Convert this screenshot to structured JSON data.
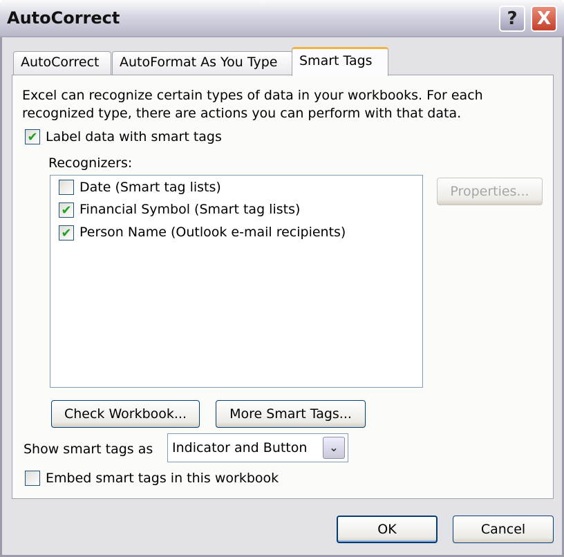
{
  "window": {
    "title": "AutoCorrect",
    "help_icon": "?",
    "close_icon": "X"
  },
  "tabs": [
    {
      "label": "AutoCorrect"
    },
    {
      "label": "AutoFormat As You Type"
    },
    {
      "label": "Smart Tags",
      "active": true
    }
  ],
  "smart_tags": {
    "description_line1": "Excel can recognize certain types of data in your workbooks.  For each",
    "description_line2": "recognized type, there are actions you can perform with that data.",
    "label_data": {
      "label": "Label data with smart tags",
      "checked": true
    },
    "recognizers_label": "Recognizers:",
    "recognizers": [
      {
        "label": "Date (Smart tag lists)",
        "checked": false
      },
      {
        "label": "Financial Symbol (Smart tag lists)",
        "checked": true
      },
      {
        "label": "Person Name (Outlook e-mail recipients)",
        "checked": true
      }
    ],
    "properties_button": "Properties...",
    "check_workbook_button": "Check Workbook...",
    "more_smart_tags_button": "More Smart Tags...",
    "show_as_label": "Show smart tags as",
    "show_as_value": "Indicator and Button",
    "embed": {
      "label": "Embed smart tags in this workbook",
      "checked": false
    }
  },
  "footer": {
    "ok": "OK",
    "cancel": "Cancel"
  },
  "check_glyph": "✔"
}
